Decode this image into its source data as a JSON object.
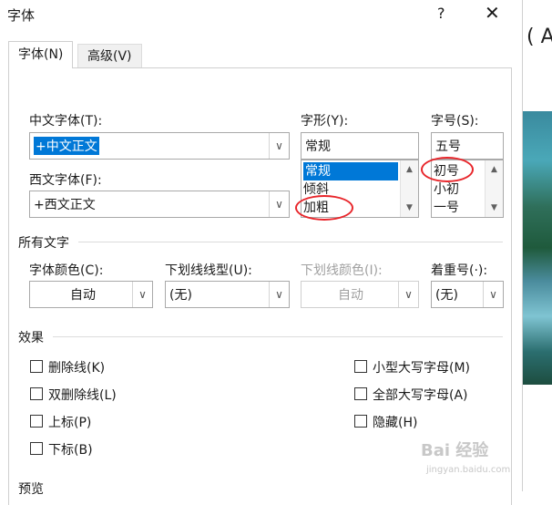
{
  "window": {
    "title": "字体",
    "help": "?",
    "close": "✕"
  },
  "tabs": [
    {
      "label": "字体(N)"
    },
    {
      "label": "高级(V)"
    }
  ],
  "font": {
    "chinese_label": "中文字体(T):",
    "chinese_value": "+中文正文",
    "western_label": "西文字体(F):",
    "western_value": "+西文正文",
    "style_label": "字形(Y):",
    "style_value": "常规",
    "style_list": [
      "常规",
      "倾斜",
      "加粗"
    ],
    "size_label": "字号(S):",
    "size_value": "五号",
    "size_list": [
      "初号",
      "小初",
      "一号"
    ]
  },
  "all_text": {
    "section_label": "所有文字",
    "color_label": "字体颜色(C):",
    "color_value": "自动",
    "underline_label": "下划线线型(U):",
    "underline_value": "(无)",
    "underline_color_label": "下划线颜色(I):",
    "underline_color_value": "自动",
    "emphasis_label": "着重号(·):",
    "emphasis_value": "(无)"
  },
  "effects": {
    "section_label": "效果",
    "left": [
      "删除线(K)",
      "双删除线(L)",
      "上标(P)",
      "下标(B)"
    ],
    "right": [
      "小型大写字母(M)",
      "全部大写字母(A)",
      "隐藏(H)"
    ]
  },
  "preview": {
    "section_label": "预览"
  },
  "background": {
    "strip_text": "( A"
  },
  "watermark": {
    "logo": "Bai 经验",
    "url": "jingyan.baidu.com"
  },
  "colors": {
    "accent": "#0078d7",
    "annotation_red": "#e8262b"
  }
}
